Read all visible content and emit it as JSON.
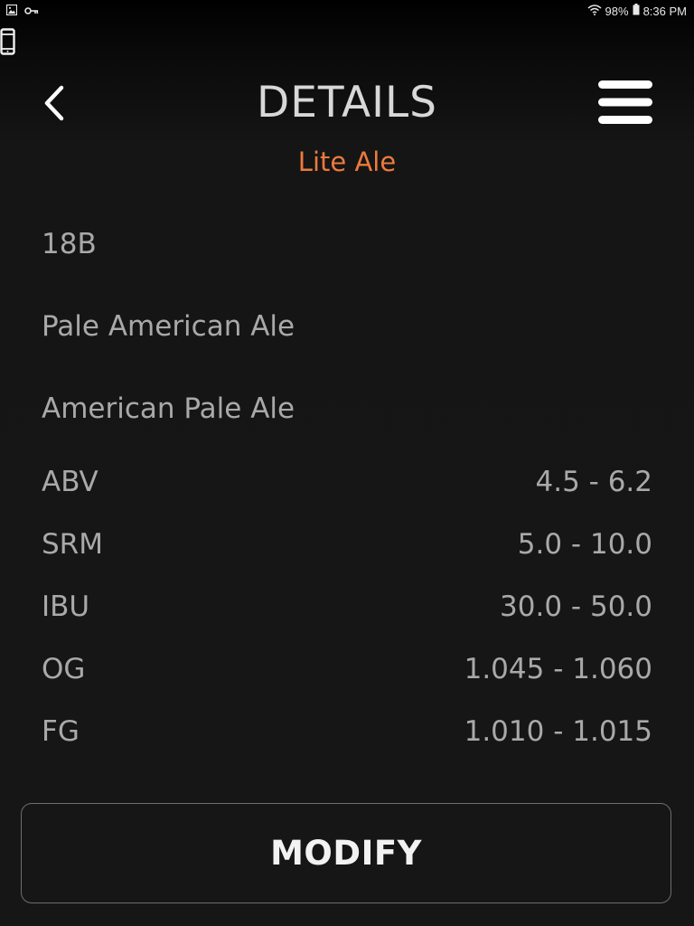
{
  "status_bar": {
    "battery": "98%",
    "time": "8:36 PM",
    "left_icons": [
      "image-icon",
      "key-icon"
    ],
    "right_icons": [
      "wifi-icon",
      "battery-icon"
    ]
  },
  "header": {
    "title": "DETAILS",
    "subtitle": "Lite Ale",
    "back_icon": "chevron-left-icon",
    "menu_icon": "hamburger-menu-icon"
  },
  "style": {
    "code": "18B",
    "category": "Pale American Ale",
    "name": "American Pale Ale"
  },
  "stats": [
    {
      "label": "ABV",
      "value": "4.5 - 6.2"
    },
    {
      "label": "SRM",
      "value": "5.0 - 10.0"
    },
    {
      "label": "IBU",
      "value": "30.0 - 50.0"
    },
    {
      "label": "OG",
      "value": "1.045 - 1.060"
    },
    {
      "label": "FG",
      "value": "1.010 - 1.015"
    }
  ],
  "actions": {
    "modify_label": "MODIFY"
  },
  "colors": {
    "accent": "#ec7a3c",
    "text": "#a9a9a9",
    "title": "#d8d8d8",
    "background": "#161616"
  }
}
